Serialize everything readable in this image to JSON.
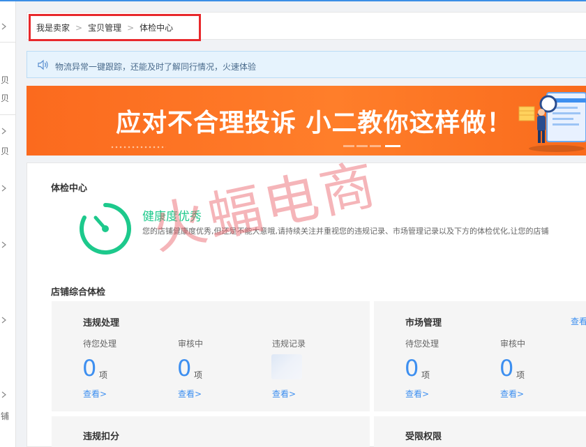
{
  "breadcrumb": {
    "items": [
      "我是卖家",
      "宝贝管理",
      "体检中心"
    ],
    "separator": ">"
  },
  "notice": {
    "text": "物流异常一键跟踪，还能及时了解同行情况，火速体验"
  },
  "banner": {
    "title": "应对不合理投诉 小二教你这样做！",
    "slide_count": 4,
    "active_slide": 4
  },
  "health_center": {
    "title": "体检中心",
    "status": "健康度优秀",
    "description": "您的店铺健康度优秀,但还是不能大意哦,请持续关注并重视您的违规记录、市场管理记录以及下方的体检优化,让您的店铺"
  },
  "watermark": "火蝠电商",
  "store_check": {
    "title": "店铺综合体检",
    "panels": [
      {
        "title": "违规处理",
        "stats": [
          {
            "label": "待您处理",
            "value": "0",
            "unit": "项",
            "link": "查看>"
          },
          {
            "label": "审核中",
            "value": "0",
            "unit": "项",
            "link": "查看>"
          },
          {
            "label": "违规记录",
            "value": "",
            "unit": "",
            "link": "查看>"
          }
        ]
      },
      {
        "title": "市场管理",
        "top_link": "查看",
        "stats": [
          {
            "label": "待您处理",
            "value": "0",
            "unit": "项",
            "link": "查看>"
          },
          {
            "label": "审核中",
            "value": "0",
            "unit": "项",
            "link": "查看>"
          }
        ]
      },
      {
        "title": "违规扣分"
      },
      {
        "title": "受限权限"
      }
    ]
  },
  "left_rail": {
    "labels": [
      "贝",
      "贝",
      "贝",
      "铺"
    ]
  },
  "colors": {
    "accent_blue": "#3d8ff0",
    "health_green": "#1dc98c",
    "banner_orange": "#fb6a1e",
    "highlight_red": "#e8282b"
  },
  "icons": {
    "notice": "speaker-icon",
    "health": "gauge-icon"
  }
}
